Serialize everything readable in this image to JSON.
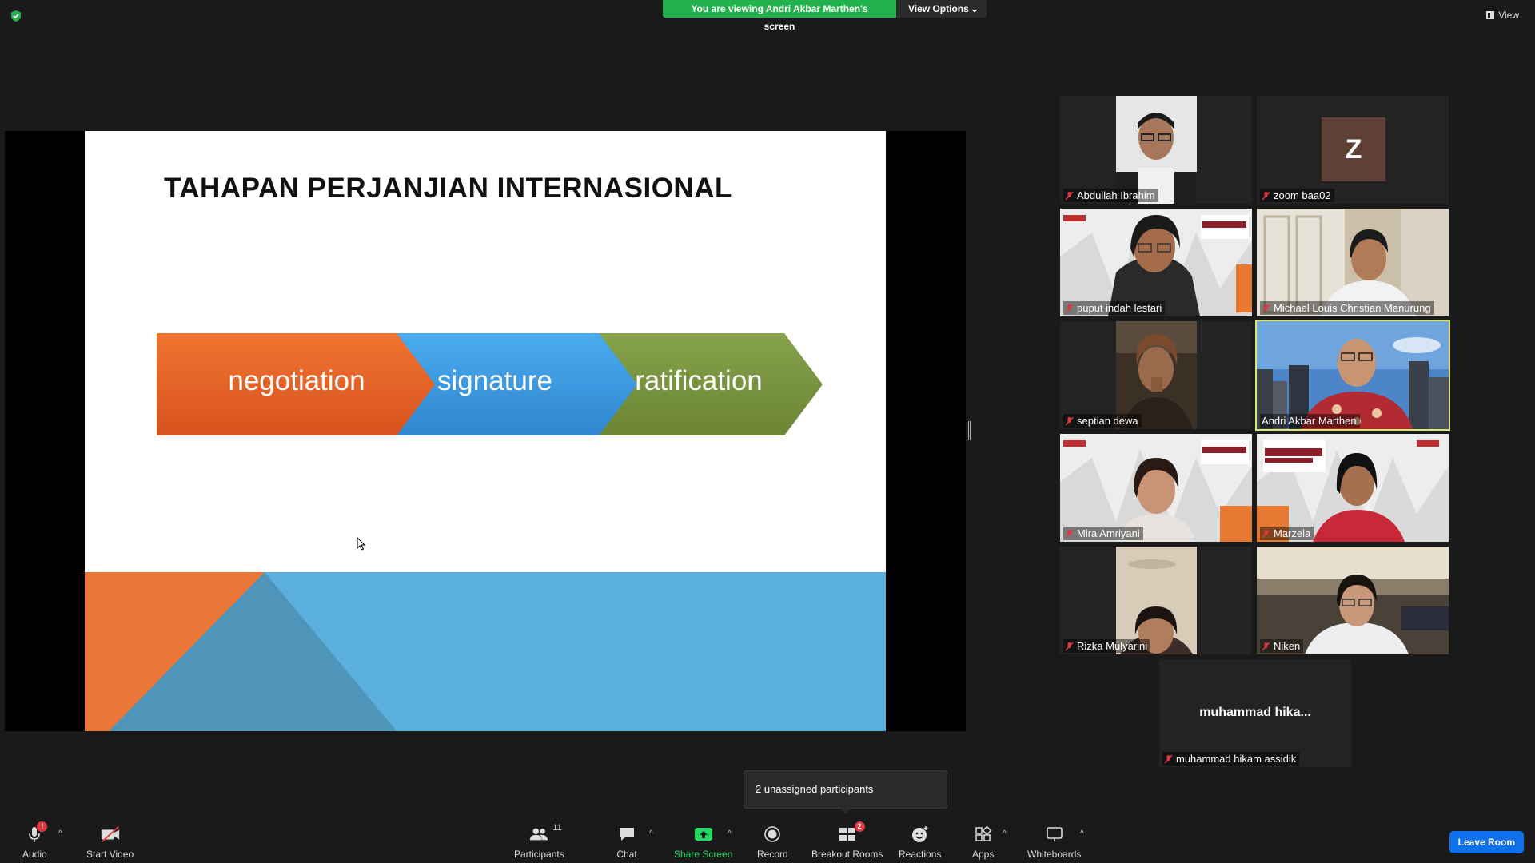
{
  "top_bar": {
    "viewing_banner": "You are viewing Andri Akbar Marthen's screen",
    "view_options": "View Options",
    "view_button": "View"
  },
  "slide": {
    "title": "TAHAPAN PERJANJIAN INTERNASIONAL",
    "steps": [
      "negotiation",
      "signature",
      "ratification"
    ],
    "colors": {
      "negotiation": "#e8642a",
      "signature": "#3a9ae0",
      "ratification": "#7a9440",
      "bottom_orange": "#ea7638",
      "bottom_blue": "#5aafdc",
      "bottom_mid": "#4f95b9"
    }
  },
  "participants_gallery": [
    {
      "name": "Abdullah Ibrahim",
      "muted": true
    },
    {
      "name": "zoom baa02",
      "muted": true,
      "avatar_letter": "Z"
    },
    {
      "name": "puput indah lestari",
      "muted": true
    },
    {
      "name": "Michael Louis Christian Manurung",
      "muted": true
    },
    {
      "name": "septian dewa",
      "muted": true
    },
    {
      "name": "Andri Akbar Marthen",
      "muted": false,
      "active_speaker": true
    },
    {
      "name": "Mira Amriyani",
      "muted": true
    },
    {
      "name": "Marzela",
      "muted": true
    },
    {
      "name": "Rizka Mulyarini",
      "muted": true
    },
    {
      "name": "Niken",
      "muted": true
    },
    {
      "name": "muhammad hikam assidik",
      "muted": true,
      "display_text": "muhammad  hika..."
    }
  ],
  "unassigned_tooltip": "2 unassigned participants",
  "toolbar": {
    "audio": "Audio",
    "audio_badge": "!",
    "start_video": "Start Video",
    "participants": "Participants",
    "participants_count": "11",
    "chat": "Chat",
    "share_screen": "Share Screen",
    "record": "Record",
    "breakout_rooms": "Breakout Rooms",
    "breakout_badge": "2",
    "reactions": "Reactions",
    "apps": "Apps",
    "whiteboards": "Whiteboards",
    "leave_room": "Leave Room"
  }
}
